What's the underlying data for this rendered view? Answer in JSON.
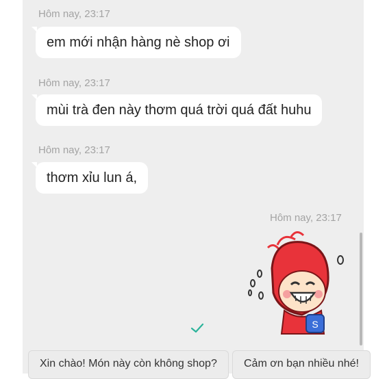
{
  "messages": [
    {
      "timestamp": "Hôm nay, 23:17",
      "text": "em mới nhận hàng nè shop ơi"
    },
    {
      "timestamp": "Hôm nay, 23:17",
      "text": "mùi trà đen này thơm quá trời quá đất huhu"
    },
    {
      "timestamp": "Hôm nay, 23:17",
      "text": "thơm xỉu lun á,"
    }
  ],
  "sent": {
    "timestamp": "Hôm nay, 23:17",
    "sticker": "laughing-red-character-sticker",
    "status_icon": "checkmark-icon",
    "sticker_badge": "S"
  },
  "quick_replies": [
    {
      "label": "Xin chào! Món này còn không shop?"
    },
    {
      "label": "Cảm ơn bạn nhiều nhé!"
    }
  ],
  "colors": {
    "background": "#eeeeee",
    "bubble": "#ffffff",
    "timestamp": "#a3a3a3",
    "check": "#2bb39a",
    "sticker_red": "#e8333a"
  }
}
